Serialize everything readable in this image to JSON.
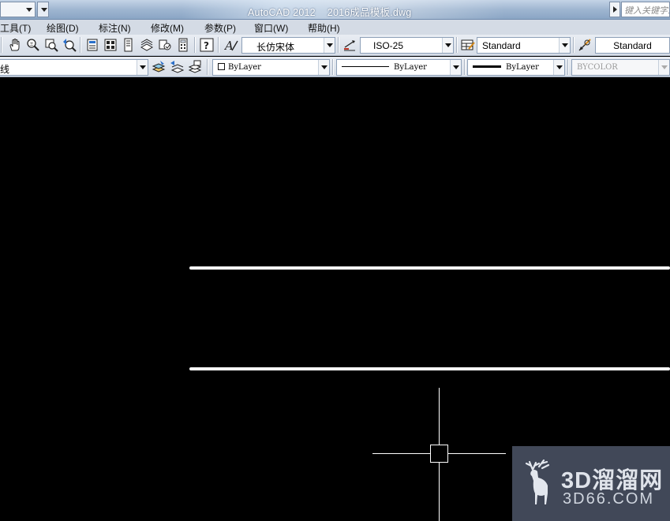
{
  "titlebar": {
    "app": "AutoCAD 2012",
    "file": "2016成品模板.dwg",
    "search_placeholder": "键入关键字或短语"
  },
  "menu": [
    {
      "label": "工具(T)"
    },
    {
      "label": "绘图(D)"
    },
    {
      "label": "标注(N)"
    },
    {
      "label": "修改(M)"
    },
    {
      "label": "参数(P)"
    },
    {
      "label": "窗口(W)"
    },
    {
      "label": "帮助(H)"
    }
  ],
  "styles_toolbar": {
    "text_style": "长仿宋体",
    "dim_style": "ISO-25",
    "table_style": "Standard",
    "multileader_style": "Standard"
  },
  "properties_toolbar": {
    "layer": "线",
    "color": "ByLayer",
    "linetype": "ByLayer",
    "lineweight": "ByLayer",
    "plot_style": "BYCOLOR"
  },
  "watermark": {
    "brand": "3D溜溜网",
    "url": "3D66.COM"
  }
}
